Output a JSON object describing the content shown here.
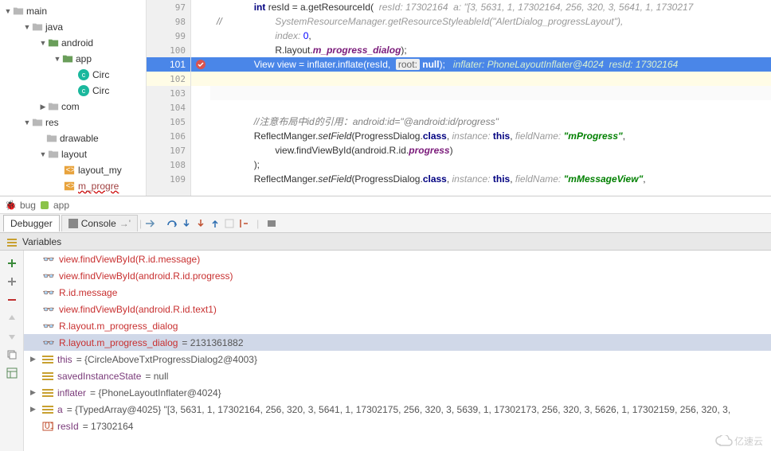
{
  "tree": {
    "main": "main",
    "java": "java",
    "android": "android",
    "app": "app",
    "circ1": "Circ",
    "circ2": "Circ",
    "com": "com",
    "res": "res",
    "drawable": "drawable",
    "layout": "layout",
    "layout_my": "layout_my",
    "m_progre": "m_progre"
  },
  "gutter": [
    "97",
    "98",
    "99",
    "100",
    "101",
    "102",
    "103",
    "104",
    "105",
    "106",
    "107",
    "108",
    "109"
  ],
  "code": {
    "l97a": "int",
    "l97b": " resId = a.getResourceId(  ",
    "l97c": "resId: 17302164  a: \"[3, 5631, 1, 17302164, 256, 320, 3, 5641, 1, 1730217",
    "l98a": "//",
    "l98b": "SystemResourceManager.getResourceStyleableId(\"AlertDialog_progressLayout\"),",
    "l99a": "index: ",
    "l99b": "0",
    "l99c": ",",
    "l100a": "R.layout.",
    "l100b": "m_progress_dialog",
    "l100c": ");",
    "l101a": "View view = inflater.inflate(resId,  ",
    "l101root": "root:",
    "l101null": "null",
    "l101b": ");   ",
    "l101hint": "inflater: PhoneLayoutInflater@4024  resId: 17302164",
    "l105a": "//注意布局中id的引用：",
    "l105b": "android:id=\"@android:id/progress\"",
    "l106a": "ReflectManger.",
    "l106b": "setField",
    "l106c": "(ProgressDialog.",
    "l106d": "class",
    "l106e": ", ",
    "l106inst": "instance: ",
    "l106this": "this",
    "l106f": ", ",
    "l106fn": "fieldName: ",
    "l106g": "\"mProgress\"",
    "l106h": ",",
    "l107a": "view.findViewById(android.R.id.",
    "l107b": "progress",
    "l107c": ")",
    "l108a": ");",
    "l109a": "ReflectManger.",
    "l109b": "setField",
    "l109c": "(ProgressDialog.",
    "l109d": "class",
    "l109e": ", ",
    "l109inst": "instance: ",
    "l109this": "this",
    "l109f": ", ",
    "l109fn": "fieldName: ",
    "l109g": "\"mMessageView\"",
    "l109h": ","
  },
  "crumb": {
    "bug": "bug",
    "app": "app"
  },
  "tabs": {
    "debugger": "Debugger",
    "console": "Console",
    "arr": "→'"
  },
  "vars": {
    "header": "Variables"
  },
  "varlist": [
    "view.findViewById(R.id.message)",
    "view.findViewById(android.R.id.progress)",
    "R.id.message",
    "view.findViewById(android.R.id.text1)",
    "R.layout.m_progress_dialog"
  ],
  "varsel": {
    "name": "R.layout.m_progress_dialog",
    "val": " = 2131361882"
  },
  "var_this": {
    "n": "this",
    "v": " = {CircleAboveTxtProgressDialog2@4003}"
  },
  "var_saved": {
    "n": "savedInstanceState",
    "v": " = null"
  },
  "var_inf": {
    "n": "inflater",
    "v": " = {PhoneLayoutInflater@4024}"
  },
  "var_a": {
    "n": "a",
    "v": " = {TypedArray@4025} \"[3, 5631, 1, 17302164, 256, 320, 3, 5641, 1, 17302175, 256, 320, 3, 5639, 1, 17302173, 256, 320, 3, 5626, 1, 17302159, 256, 320, 3,"
  },
  "var_res": {
    "n": "resId",
    "v": " = 17302164"
  },
  "watermark": "亿速云"
}
